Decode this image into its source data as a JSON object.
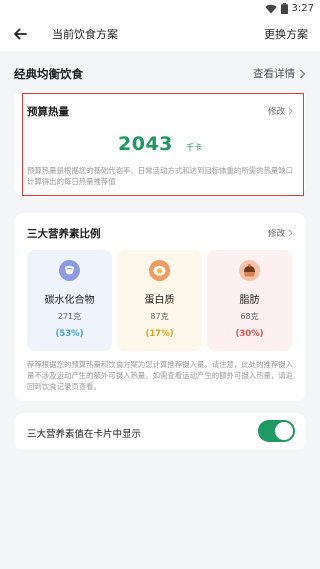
{
  "status_bar": {
    "time": "3:27"
  },
  "header": {
    "title": "当前饮食方案",
    "action_label": "更换方案"
  },
  "plan": {
    "name": "经典均衡饮食",
    "detail_link": "查看详情"
  },
  "budget": {
    "label": "预算热量",
    "modify_label": "修改",
    "value": "2043",
    "unit": "千卡",
    "description": "预算热量是根据您的基础代谢率、日常活动方式和达到目标体重的所需的热量缺口计算得出的每日热量推荐值"
  },
  "macros": {
    "label": "三大营养素比例",
    "modify_label": "修改",
    "items": [
      {
        "name": "碳水化合物",
        "grams": "271克",
        "percent": "(53%)",
        "icon": "shield-carb-icon",
        "bg": "#eef3fc",
        "icon_color": "#7b8ed8",
        "percent_color": "#3da8d6"
      },
      {
        "name": "蛋白质",
        "grams": "87克",
        "percent": "(17%)",
        "icon": "egg-icon",
        "bg": "#fdf8ea",
        "icon_color": "#f0925a",
        "percent_color": "#e0a21c"
      },
      {
        "name": "脂肪",
        "grams": "68克",
        "percent": "(30%)",
        "icon": "cake-icon",
        "bg": "#fcf0f0",
        "icon_color": "#f4b59a",
        "percent_color": "#e5534b"
      }
    ],
    "description": "荐荐根据您的预算热量和饮食方案为您计算推荐摄入量。请注意，此处的推荐摄入量不涉及运动产生的额外可摄入热量。如需查看运动产生的额外可摄入热量，请返回到饮食记录页查看。"
  },
  "display_toggle": {
    "label": "三大营养素值在卡片中显示",
    "enabled": true
  },
  "colors": {
    "accent": "#1c9a61",
    "highlight_border": "#e53935"
  }
}
